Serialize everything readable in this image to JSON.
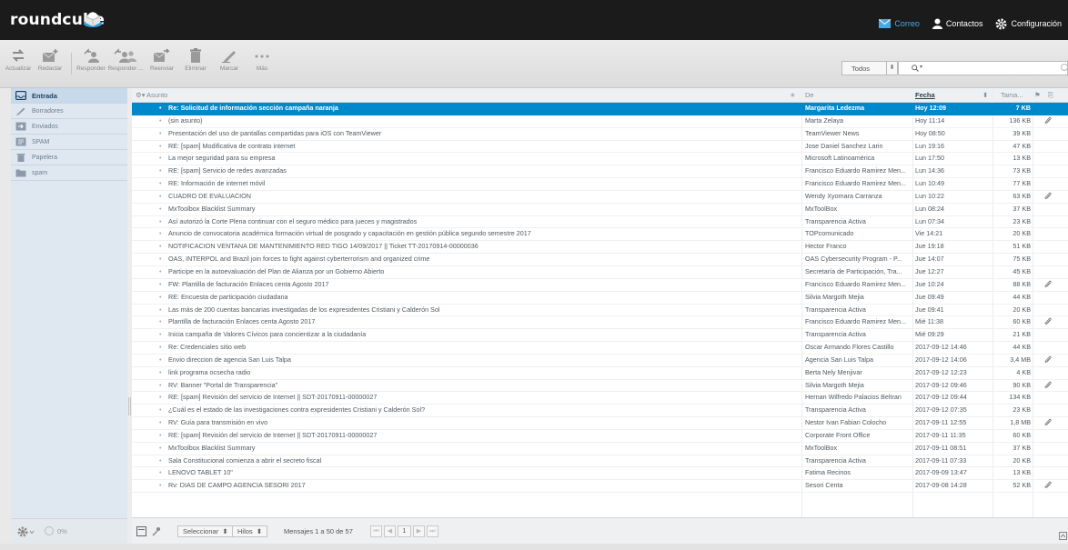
{
  "app": {
    "logo_text": "roundcube"
  },
  "topnav": [
    {
      "label": "Correo",
      "icon": "mail-icon",
      "active": true
    },
    {
      "label": "Contactos",
      "icon": "contacts-icon",
      "active": false
    },
    {
      "label": "Configuración",
      "icon": "settings-gear-icon",
      "active": false
    }
  ],
  "toolbar": {
    "refresh": "Actualizar",
    "compose": "Redactar",
    "reply": "Responder",
    "reply_all": "Responder ...",
    "forward": "Reenviar",
    "delete": "Eliminar",
    "mark": "Marcar",
    "more": "Más"
  },
  "filter": {
    "selected": "Todos"
  },
  "sidebar": {
    "folders": [
      {
        "label": "Entrada",
        "icon": "inbox-icon",
        "selected": true
      },
      {
        "label": "Borradores",
        "icon": "drafts-pencil-icon",
        "selected": false
      },
      {
        "label": "Enviados",
        "icon": "sent-icon",
        "selected": false
      },
      {
        "label": "SPAM",
        "icon": "spam-icon",
        "selected": false
      },
      {
        "label": "Papelera",
        "icon": "trash-icon",
        "selected": false
      },
      {
        "label": "spam",
        "icon": "folder-icon",
        "selected": false
      }
    ],
    "quota": "0%"
  },
  "list": {
    "columns": {
      "subject": "Asunto",
      "from": "De",
      "date": "Fecha",
      "size": "Tama..."
    },
    "messages": [
      {
        "subject": "Re: Solicitud de información sección campaña naranja",
        "from": "Margarita Ledezma",
        "date": "Hoy 12:09",
        "size": "7 KB",
        "attachment": false
      },
      {
        "subject": "(sin asunto)",
        "from": "Marta Zelaya",
        "date": "Hoy 11:14",
        "size": "136 KB",
        "attachment": true
      },
      {
        "subject": "Presentación del uso de pantallas compartidas para iOS con TeamViewer",
        "from": "TeamViewer News",
        "date": "Hoy 08:50",
        "size": "39 KB",
        "attachment": false
      },
      {
        "subject": "RE: [spam] Modificativa de contrato internet",
        "from": "Jose Daniel Sanchez Larin",
        "date": "Lun 19:16",
        "size": "47 KB",
        "attachment": false
      },
      {
        "subject": "La mejor seguridad para su empresa",
        "from": "Microsoft Latinoamérica",
        "date": "Lun 17:50",
        "size": "13 KB",
        "attachment": false
      },
      {
        "subject": "RE: [spam] Servicio de redes avanzadas",
        "from": "Francisco Eduardo Ramirez Men...",
        "date": "Lun 14:36",
        "size": "73 KB",
        "attachment": false
      },
      {
        "subject": "RE: Información de internet móvil",
        "from": "Francisco Eduardo Ramirez Men...",
        "date": "Lun 10:49",
        "size": "77 KB",
        "attachment": false
      },
      {
        "subject": "CUADRO DE EVALUACION",
        "from": "Wendy Xyomara Carranza",
        "date": "Lun 10:22",
        "size": "63 KB",
        "attachment": true
      },
      {
        "subject": "MxToolbox Blacklist Summary",
        "from": "MxToolBox",
        "date": "Lun 08:24",
        "size": "37 KB",
        "attachment": false
      },
      {
        "subject": "Así autorizó la Corte Plena continuar con el seguro médico para jueces y magistrados",
        "from": "Transparencia Activa",
        "date": "Lun 07:34",
        "size": "23 KB",
        "attachment": false
      },
      {
        "subject": "Anuncio de convocatoria académica formación virtual de posgrado y capacitación en gestión pública segundo semestre 2017",
        "from": "TOPcomunicado",
        "date": "Vie 14:21",
        "size": "20 KB",
        "attachment": false
      },
      {
        "subject": "NOTIFICACION VENTANA DE MANTENIMIENTO RED TIGO 14/09/2017 || Ticket TT-20170914-00000036",
        "from": "Hector Franco",
        "date": "Jue 19:18",
        "size": "51 KB",
        "attachment": false
      },
      {
        "subject": "OAS, INTERPOL and Brazil join forces to fight against cyberterrorism and organized crime",
        "from": "OAS Cybersecurity Program - P...",
        "date": "Jue 14:07",
        "size": "75 KB",
        "attachment": false
      },
      {
        "subject": "Participe en la autoevaluación del Plan de Alianza por un Gobierno Abierto",
        "from": "Secretaría de Participación, Tra...",
        "date": "Jue 12:27",
        "size": "45 KB",
        "attachment": false
      },
      {
        "subject": "FW: Plantilla de facturación Enlaces centa Agosto 2017",
        "from": "Francisco Eduardo Ramirez Men...",
        "date": "Jue 10:24",
        "size": "88 KB",
        "attachment": true
      },
      {
        "subject": "RE: Encuesta de participación ciudadana",
        "from": "Silvia Margoth Mejia",
        "date": "Jue 09:49",
        "size": "44 KB",
        "attachment": false
      },
      {
        "subject": "Las más de 200 cuentas bancarias investigadas de los expresidentes Cristiani y Calderón Sol",
        "from": "Transparencia Activa",
        "date": "Jue 09:41",
        "size": "20 KB",
        "attachment": false
      },
      {
        "subject": "Plantilla de facturación Enlaces centa Agosto 2017",
        "from": "Francisco Eduardo Ramirez Men...",
        "date": "Mié 11:38",
        "size": "60 KB",
        "attachment": true
      },
      {
        "subject": "Inicia campaña de Valores Cívicos para concientizar a la ciudadanía",
        "from": "Transparencia Activa",
        "date": "Mié 09:29",
        "size": "21 KB",
        "attachment": false
      },
      {
        "subject": "Re: Credenciales sitio web",
        "from": "Oscar Armando Flores Castillo",
        "date": "2017-09-12 14:46",
        "size": "44 KB",
        "attachment": false
      },
      {
        "subject": "Envio direccion de agencia San Luis Talpa",
        "from": "Agencia San Luis Talpa",
        "date": "2017-09-12 14:06",
        "size": "3,4 MB",
        "attachment": true
      },
      {
        "subject": "link programa ocsecha radio",
        "from": "Berta Nely Menjivar",
        "date": "2017-09-12 12:23",
        "size": "4 KB",
        "attachment": false
      },
      {
        "subject": "RV: Banner \"Portal de Transparencia\"",
        "from": "Silvia Margoth Mejia",
        "date": "2017-09-12 09:46",
        "size": "90 KB",
        "attachment": true
      },
      {
        "subject": "RE: [spam] Revisión del servicio de Internet || SDT-20170911-00000027",
        "from": "Hernan Wilfredo Palacios Beltran",
        "date": "2017-09-12 09:44",
        "size": "134 KB",
        "attachment": false
      },
      {
        "subject": "¿Cuál es el estado de las investigaciones contra expresidentes Cristiani y Calderón Sol?",
        "from": "Transparencia Activa",
        "date": "2017-09-12 07:35",
        "size": "23 KB",
        "attachment": false
      },
      {
        "subject": "RV: Guía para transmisión en vivo",
        "from": "Nestor Ivan Fabian Colocho",
        "date": "2017-09-11 12:55",
        "size": "1,8 MB",
        "attachment": true
      },
      {
        "subject": "RE: [spam] Revisión del servicio de Internet || SDT-20170911-00000027",
        "from": "Corporate Front Office",
        "date": "2017-09-11 11:35",
        "size": "60 KB",
        "attachment": false
      },
      {
        "subject": "MxToolbox Blacklist Summary",
        "from": "MxToolBox",
        "date": "2017-09-11 08:51",
        "size": "37 KB",
        "attachment": false
      },
      {
        "subject": "Sala Constitucional comienza a abrir el secreto fiscal",
        "from": "Transparencia Activa",
        "date": "2017-09-11 07:33",
        "size": "20 KB",
        "attachment": false
      },
      {
        "subject": "LENOVO TABLET 10\"",
        "from": "Fatima Recinos",
        "date": "2017-09-09 13:47",
        "size": "13 KB",
        "attachment": false
      },
      {
        "subject": "Rv: DIAS DE CAMPO AGENCIA SESORI 2017",
        "from": "Sesori Centa",
        "date": "2017-09-08 14:28",
        "size": "52 KB",
        "attachment": true
      }
    ]
  },
  "statusbar": {
    "select": "Seleccionar",
    "threads": "Hilos",
    "count": "Mensajes 1 a 50 de 57",
    "page": "1"
  },
  "colors": {
    "accent": "#0088cc",
    "header_bg": "#1b1b1b",
    "active_nav": "#48a9e6"
  }
}
